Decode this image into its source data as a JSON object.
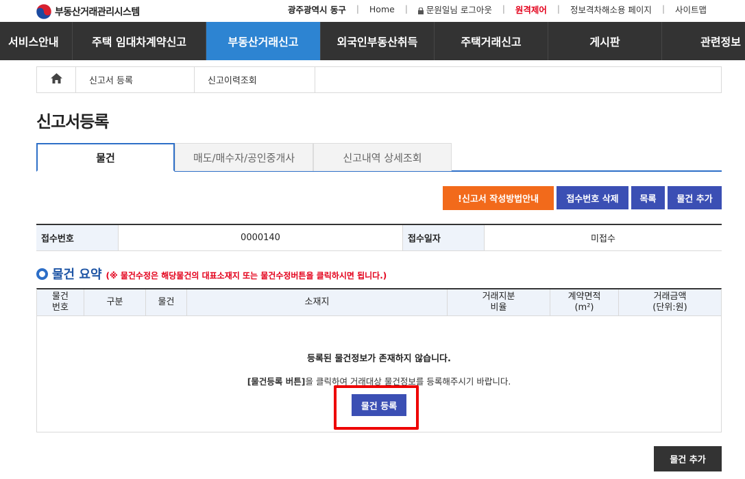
{
  "header": {
    "logo_text": "부동산거래관리시스템",
    "util_links": {
      "region": "광주광역시 동구",
      "home": "Home",
      "user": "문원일님 로그아웃",
      "remote": "원격제어",
      "accessibility": "정보격차해소용 페이지",
      "sitemap": "사이트맵"
    }
  },
  "nav": {
    "items": [
      {
        "label": "서비스안내"
      },
      {
        "label": "주택 임대차계약신고"
      },
      {
        "label": "부동산거래신고"
      },
      {
        "label": "외국인부동산취득"
      },
      {
        "label": "주택거래신고"
      },
      {
        "label": "게시판"
      },
      {
        "label": "관련정보"
      }
    ],
    "active_color": "#2d84d2"
  },
  "breadcrumb": {
    "items": [
      "신고서 등록",
      "신고이력조회"
    ]
  },
  "page_title": "신고서등록",
  "tabs": [
    {
      "label": "물건",
      "active": true
    },
    {
      "label": "매도/매수자/공인중개사",
      "active": false
    },
    {
      "label": "신고내역 상세조회",
      "active": false
    }
  ],
  "actions": {
    "guide": "!신고서 작성방법안내",
    "delete_receipt": "접수번호 삭제",
    "list": "목록",
    "add_property": "물건 추가"
  },
  "receipt": {
    "number_label": "접수번호",
    "number_value": "0000140",
    "date_label": "접수일자",
    "date_value": "미접수"
  },
  "summary": {
    "title": "물건 요약",
    "note": "(※ 물건수정은 해당물건의 대표소재지 또는 물건수정버튼을 클릭하시면 됩니다.)"
  },
  "property_table": {
    "columns": [
      {
        "line1": "물건",
        "line2": "번호"
      },
      {
        "line1": "구분",
        "line2": ""
      },
      {
        "line1": "물건",
        "line2": ""
      },
      {
        "line1": "소재지",
        "line2": ""
      },
      {
        "line1": "거래지분",
        "line2": "비율"
      },
      {
        "line1": "계약면적",
        "line2": "(m²)"
      },
      {
        "line1": "거래금액",
        "line2": "(단위:원)"
      }
    ],
    "empty_message": "등록된 물건정보가 존재하지 않습니다.",
    "empty_guide_bold": "[물건등록 버튼]",
    "empty_guide_rest": "을 클릭하여  거래대상 물건정보를 등록해주시기 바랍니다.",
    "register_button": "물건 등록"
  },
  "bottom": {
    "add_property": "물건 추가"
  },
  "colors": {
    "nav_bg": "#333333",
    "primary_blue": "#3b4fb4",
    "guide_orange": "#f26a1b",
    "highlight_red": "#ee0000"
  }
}
